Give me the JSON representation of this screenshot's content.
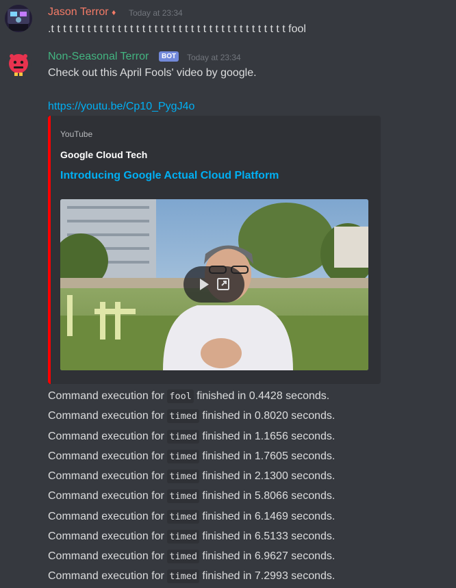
{
  "messages": [
    {
      "author": "Jason Terror",
      "author_suffix": "♦",
      "timestamp": "Today at 23:34",
      "content": ".t t t t t t t t t t t t t t t t t t t t t t t t t t t t t t t t t t t t t t t fool",
      "name_color": "#f47b67"
    },
    {
      "author": "Non-Seasonal Terror",
      "bot_tag": "BOT",
      "timestamp": "Today at 23:34",
      "content": "Check out this April Fools' video by google.",
      "link": "https://youtu.be/Cp10_PygJ4o",
      "name_color": "#43b581"
    }
  ],
  "embed": {
    "provider": "YouTube",
    "author": "Google Cloud Tech",
    "title": "Introducing Google Actual Cloud Platform",
    "accent_color": "#ff0000"
  },
  "commands": {
    "prefix": "Command execution for",
    "middle": "finished in",
    "rows": [
      {
        "cmd": "fool",
        "time": "0.4428 seconds."
      },
      {
        "cmd": "timed",
        "time": "0.8020 seconds."
      },
      {
        "cmd": "timed",
        "time": "1.1656 seconds."
      },
      {
        "cmd": "timed",
        "time": "1.7605 seconds."
      },
      {
        "cmd": "timed",
        "time": "2.1300 seconds."
      },
      {
        "cmd": "timed",
        "time": "5.8066 seconds."
      },
      {
        "cmd": "timed",
        "time": "6.1469 seconds."
      },
      {
        "cmd": "timed",
        "time": "6.5133 seconds."
      },
      {
        "cmd": "timed",
        "time": "6.9627 seconds."
      },
      {
        "cmd": "timed",
        "time": "7.2993 seconds."
      }
    ]
  }
}
